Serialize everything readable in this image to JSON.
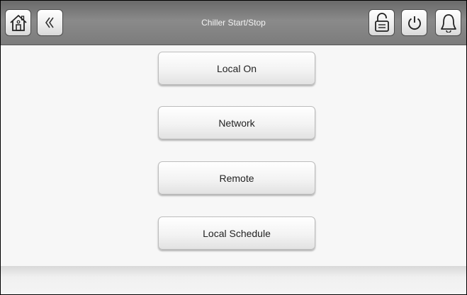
{
  "header": {
    "title": "Chiller Start/Stop",
    "icons": {
      "home": "home-icon",
      "back": "back-chevron-icon",
      "lock": "padlock-icon",
      "power": "power-icon",
      "alarm": "bell-icon"
    }
  },
  "buttons": [
    {
      "label": "Local On"
    },
    {
      "label": "Network"
    },
    {
      "label": "Remote"
    },
    {
      "label": "Local Schedule"
    }
  ]
}
